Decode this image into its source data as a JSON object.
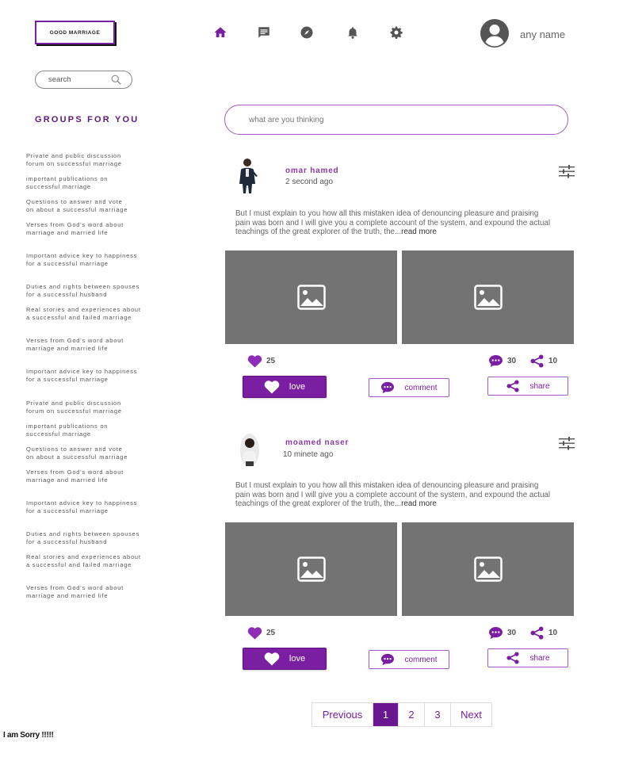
{
  "header": {
    "logo_text": "GOOD MARRIAGE",
    "nav": [
      {
        "name": "home-icon",
        "active": true
      },
      {
        "name": "message-icon",
        "active": false
      },
      {
        "name": "explore-icon",
        "active": false
      },
      {
        "name": "bell-icon",
        "active": false
      },
      {
        "name": "gear-icon",
        "active": false
      }
    ],
    "username": "any name"
  },
  "sidebar": {
    "search_placeholder": "search",
    "groups_title": "GROUPS FOR YOU",
    "groups": [
      "Private and public discussion\nforum on successful marriage",
      "important publications on\nsuccessful marriage",
      "Questions to answer and vote\non about a successful marriage",
      "Verses from God's word about\nmarriage and married life",
      "Important advice key to happiness\nfor a successful marriage",
      "Duties and rights between spouses\nfor a successful husband",
      "Real stories and experiences about\na successful and failed marriage",
      "Verses from God's word about\nmarriage and married life",
      "Important advice key to happiness\nfor a successful marriage",
      "Private and public discussion\nforum on successful marriage",
      "important publications on\nsuccessful marriage",
      "Questions to answer and vote\non about a successful marriage",
      "Verses from God's word about\nmarriage and married life",
      "Important advice key to happiness\nfor a successful marriage",
      "Duties and rights between spouses\nfor a successful husband",
      "Real stories and experiences about\na successful and failed marriage",
      "Verses from God's word about\nmarriage and married life"
    ]
  },
  "composer": {
    "placeholder": "what are you thinking"
  },
  "posts": [
    {
      "author": "omar hamed",
      "time": "2 second ago",
      "text": "But I must explain to you how all this mistaken idea of denouncing pleasure and praising pain was born and I will give you a complete account of the system, and expound the actual teachings of the great explorer of the truth, the...",
      "read_more": "read more",
      "likes": "25",
      "comments": "30",
      "shares": "10",
      "love_label": "love",
      "comment_label": "comment",
      "share_label": "share"
    },
    {
      "author": "moamed naser",
      "time": "10 minete ago",
      "text": "But I must explain to you how all this mistaken idea of denouncing pleasure and praising pain was born and I will give you a complete account of the system, and expound the actual teachings of the great explorer of the truth, the...",
      "read_more": "read more",
      "likes": "25",
      "comments": "30",
      "shares": "10",
      "love_label": "love",
      "comment_label": "comment",
      "share_label": "share"
    }
  ],
  "pagination": {
    "previous": "Previous",
    "pages": [
      "1",
      "2",
      "3"
    ],
    "current": "1",
    "next": "Next"
  },
  "footer_text": "I am Sorry !!!!!",
  "colors": {
    "accent": "#7b1fa2",
    "image_placeholder": "#737373"
  }
}
